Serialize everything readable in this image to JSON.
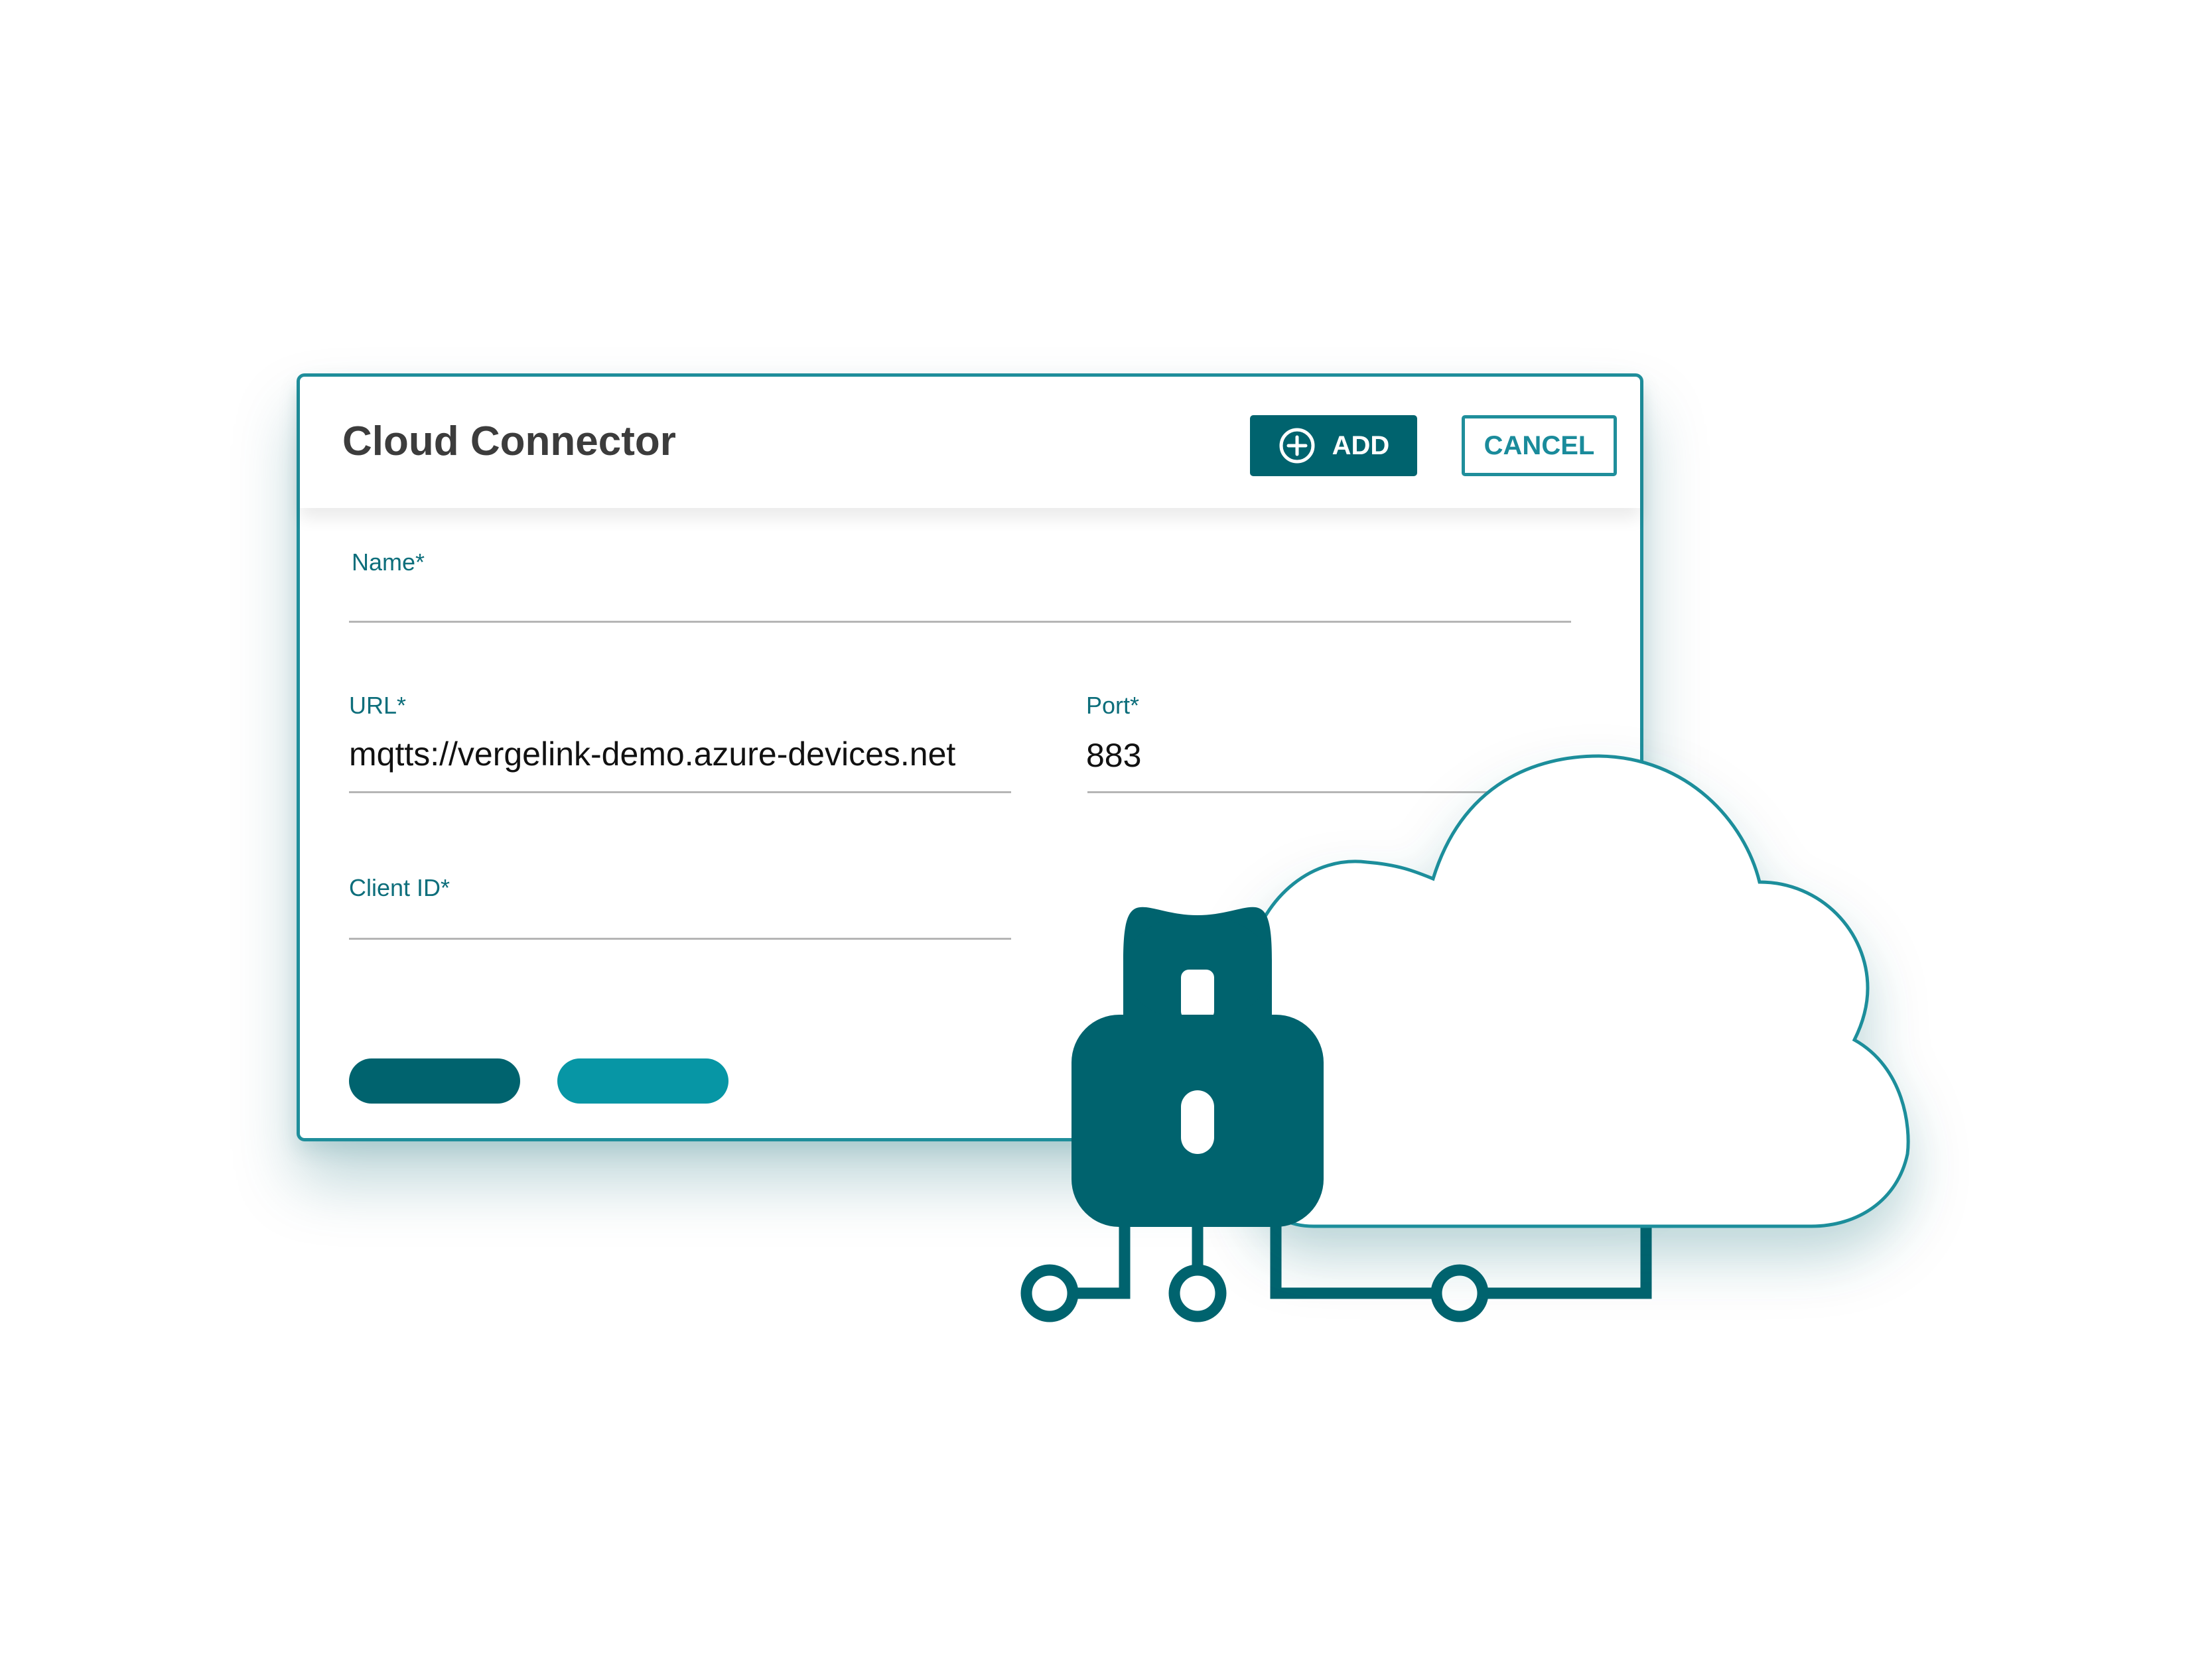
{
  "dialog": {
    "title": "Cloud Connector",
    "add_label": "ADD",
    "cancel_label": "CANCEL",
    "fields": {
      "name": {
        "label": "Name*",
        "value": ""
      },
      "url": {
        "label": "URL*",
        "value": "mqtts://vergelink-demo.azure-devices.net"
      },
      "port": {
        "label": "Port*",
        "value": "883"
      },
      "client_id": {
        "label": "Client ID*",
        "value": ""
      }
    }
  },
  "icons": {
    "add": "plus-circle-icon",
    "illustration_lock": "padlock-icon",
    "illustration_cloud": "cloud-icon",
    "illustration_circuit": "circuit-icon"
  },
  "colors": {
    "primary_dark": "#00636e",
    "primary_light": "#0796a5",
    "outline": "#1f8e9b",
    "label": "#0d6e7b"
  }
}
